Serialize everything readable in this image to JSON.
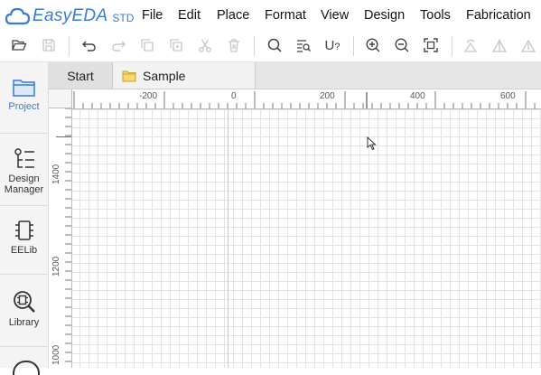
{
  "app": {
    "logo_text": "EasyEDA",
    "logo_suffix": "STD",
    "brand_color": "#3a7bd5"
  },
  "menu": {
    "items": [
      "File",
      "Edit",
      "Place",
      "Format",
      "View",
      "Design",
      "Tools",
      "Fabrication"
    ]
  },
  "toolbar": {
    "icons": [
      "open-folder-icon",
      "save-icon",
      "undo-icon",
      "redo-icon",
      "copy-icon",
      "duplicate-icon",
      "cut-icon",
      "delete-icon",
      "search-icon",
      "find-similar-icon",
      "u-question-icon",
      "zoom-in-icon",
      "zoom-out-icon",
      "fit-screen-icon",
      "rotate-left-icon",
      "flip-icon",
      "triangle-icon"
    ]
  },
  "sidebar": {
    "items": [
      {
        "label": "Project",
        "icon": "folder-icon",
        "active": true
      },
      {
        "label": "Design\nManager",
        "icon": "tree-icon"
      },
      {
        "label": "EELib",
        "icon": "chip-icon"
      },
      {
        "label": "Library",
        "icon": "library-search-icon"
      }
    ],
    "label_project": "Project",
    "label_design": "Design",
    "label_manager": "Manager",
    "label_eelib": "EELib",
    "label_library": "Library",
    "active_color": "#3a7bd5"
  },
  "tabs": {
    "start": "Start",
    "sample": "Sample"
  },
  "ruler": {
    "top_labels": [
      "-200",
      "0",
      "200",
      "400",
      "600"
    ],
    "left_labels": [
      "1400",
      "1200",
      "1000"
    ]
  }
}
